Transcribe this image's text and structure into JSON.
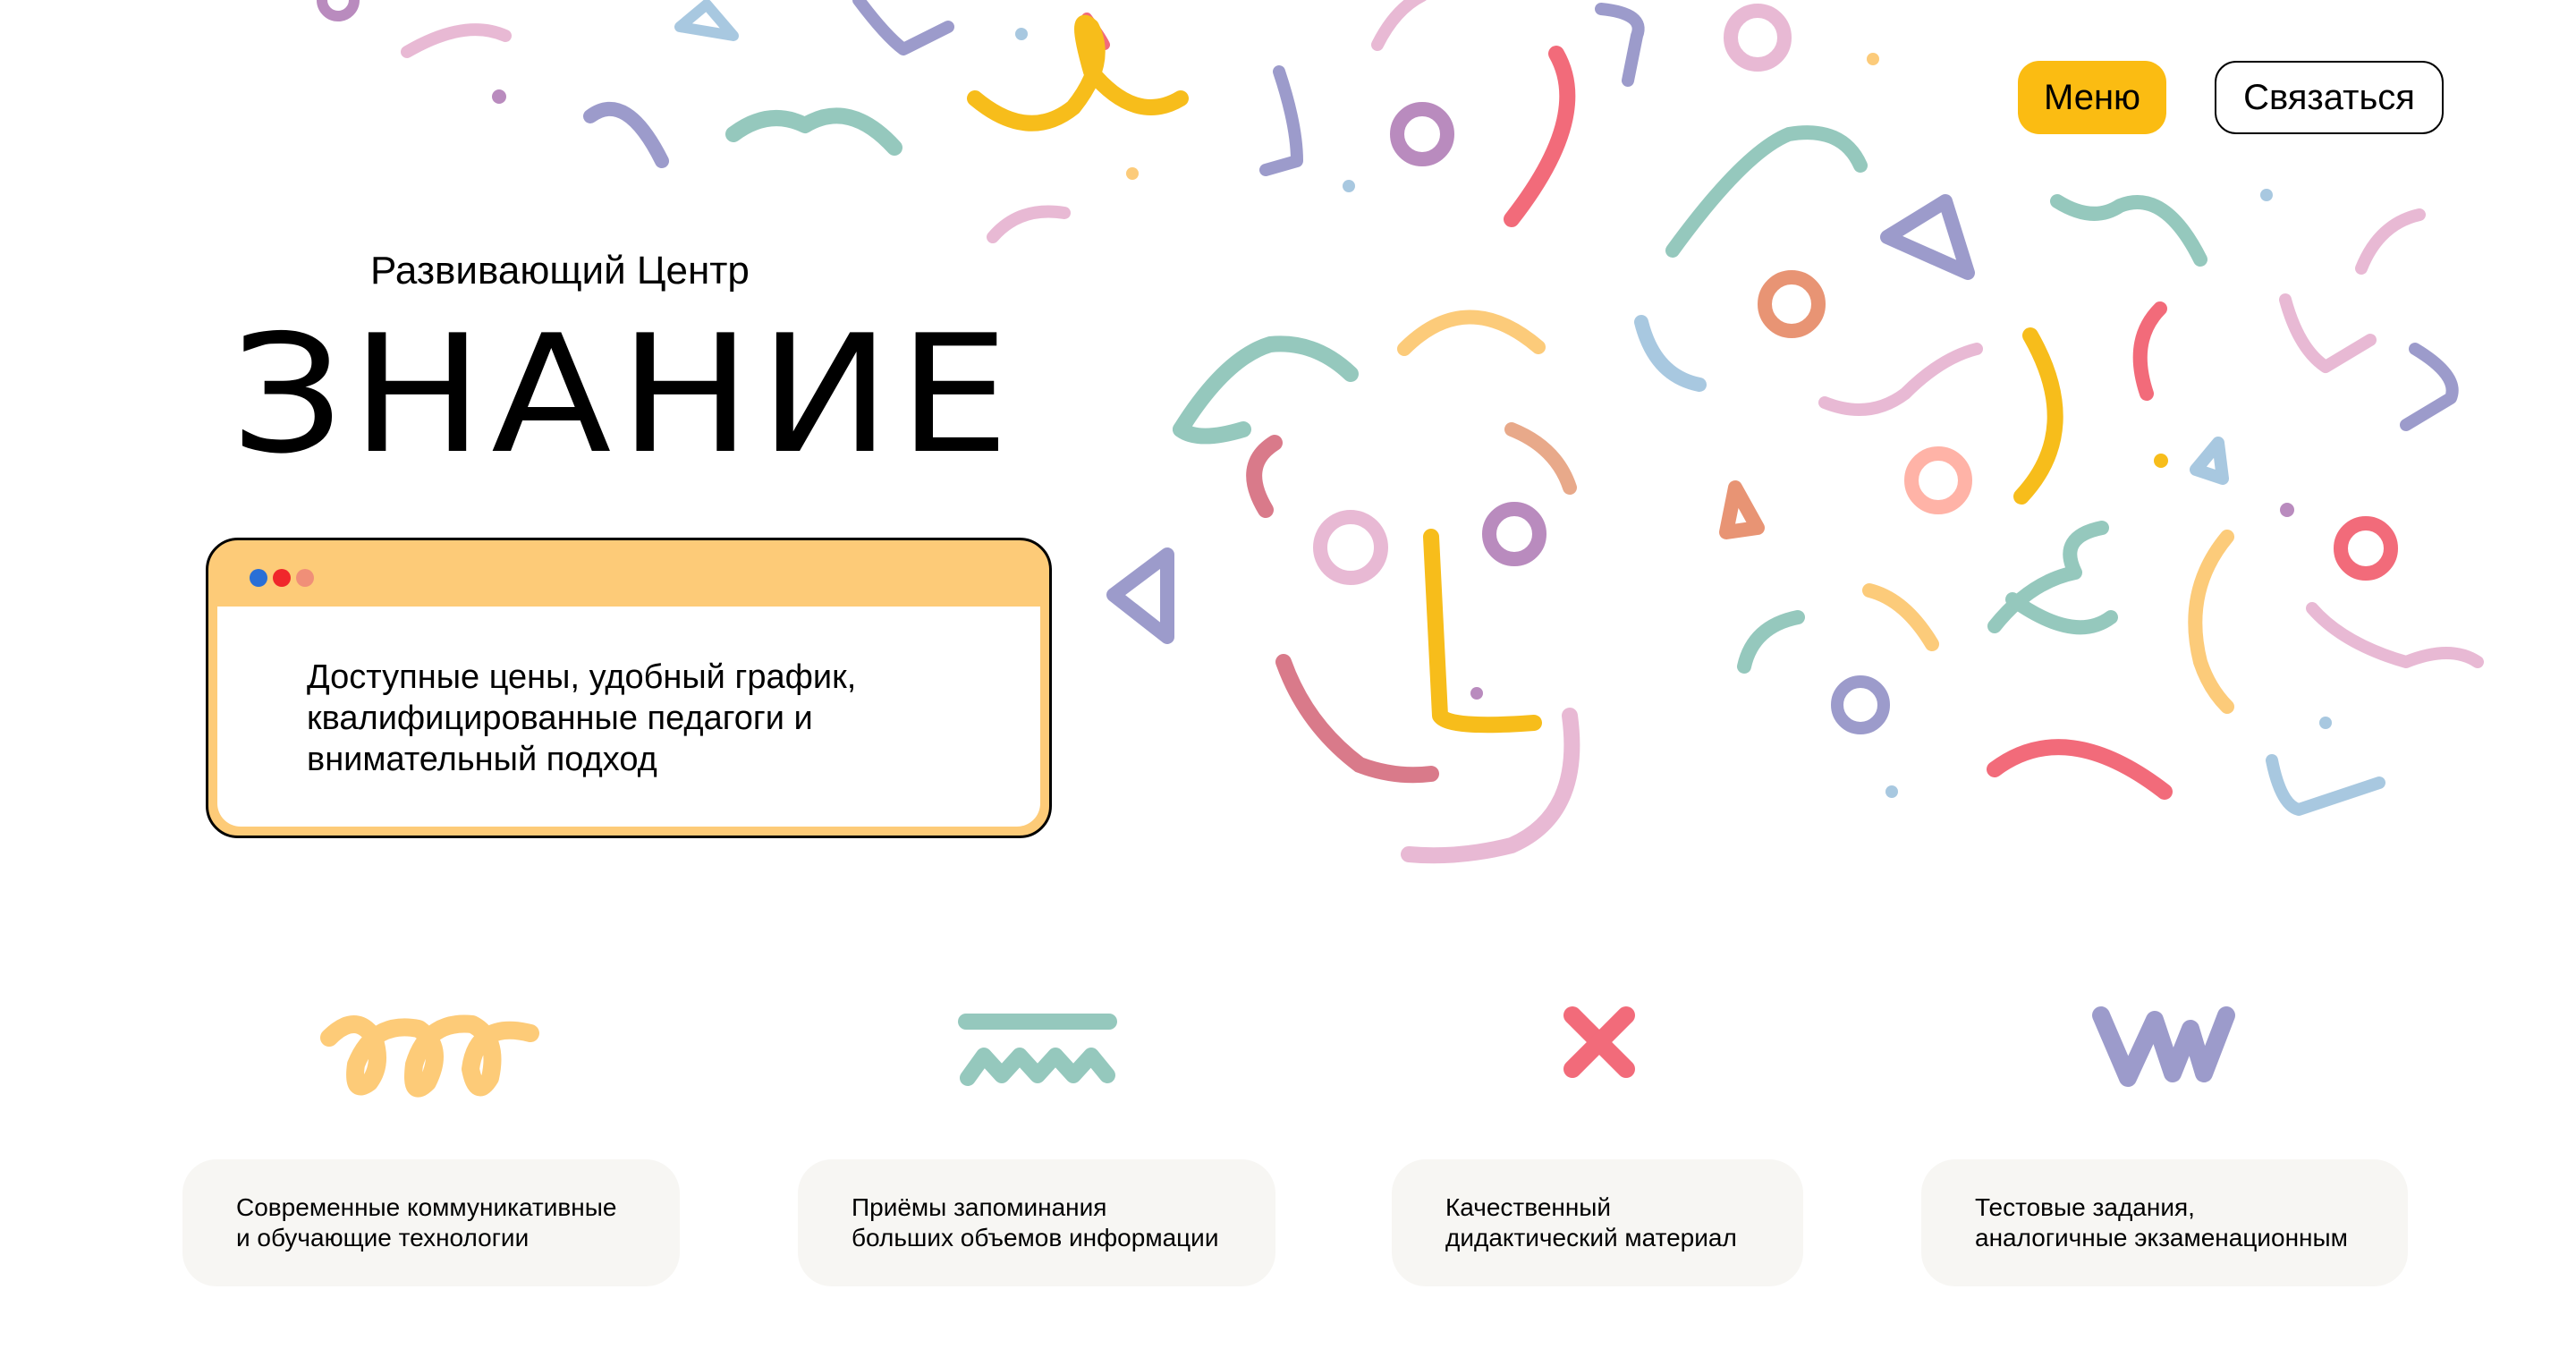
{
  "header": {
    "menu_label": "Меню",
    "contact_label": "Связаться"
  },
  "hero": {
    "subtitle": "Развивающий Центр",
    "title": "ЗНАНИЕ",
    "card_text": "Доступные цены, удобный график, квалифицированные педагоги и внимательный подход",
    "card_dot_colors": [
      "#2A6FD6",
      "#F0272B",
      "#F08F78"
    ]
  },
  "features": [
    {
      "icon": "loops-doodle-icon",
      "text": "Современные коммуникативные\nи обучающие технологии"
    },
    {
      "icon": "line-zigzag-doodle-icon",
      "text": "Приёмы запоминания\nбольших объемов информации"
    },
    {
      "icon": "cross-doodle-icon",
      "text": "Качественный\nдидактический материал"
    },
    {
      "icon": "w-doodle-icon",
      "text": "Тестовые задания,\nаналогичные экзаменационным"
    }
  ],
  "colors": {
    "accent_yellow": "#FBBC12",
    "card_header": "#FDCB78",
    "feature_bg": "#F7F6F3",
    "confetti": [
      "#E8B9D4",
      "#9C9BCB",
      "#95C8BD",
      "#F7BD1B",
      "#F26B7A",
      "#A8C8E0",
      "#B98BBE",
      "#E89474",
      "#FCCB7A",
      "#FFB3A7"
    ]
  }
}
